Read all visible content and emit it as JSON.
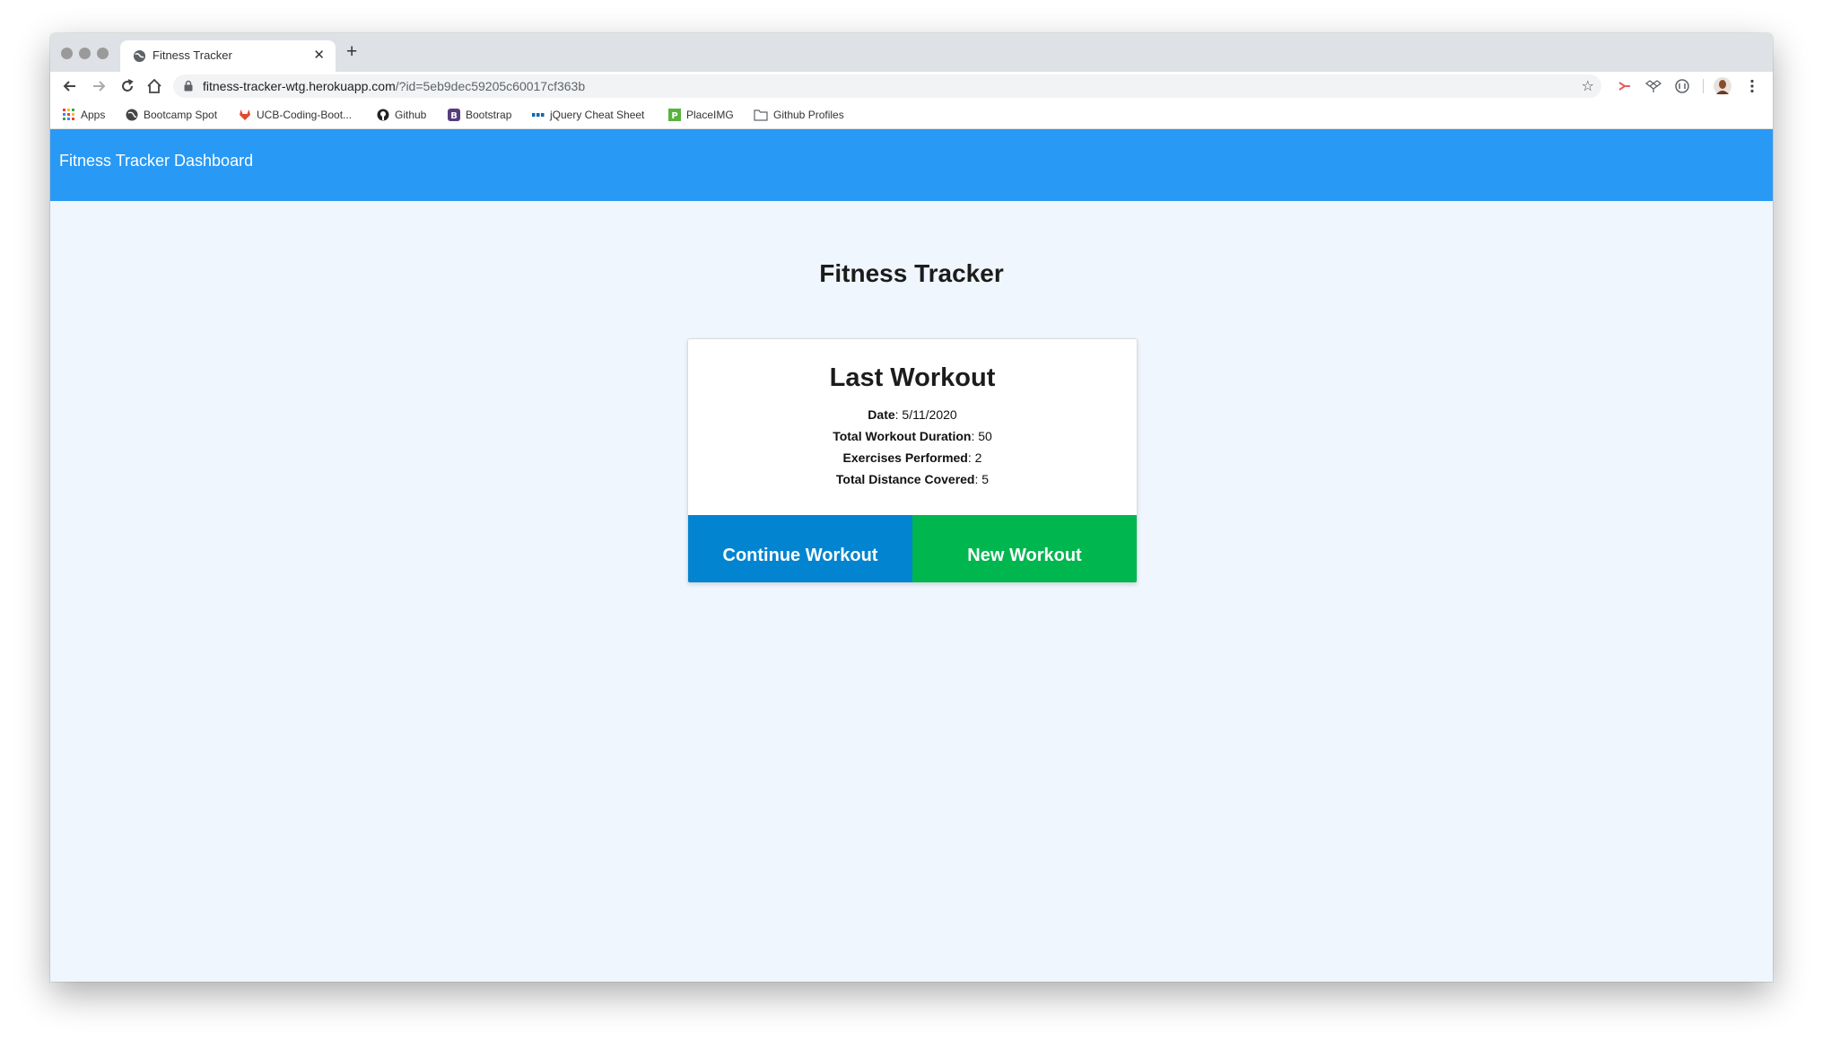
{
  "browser": {
    "tab_title": "Fitness Tracker",
    "tab_close": "✕",
    "new_tab": "+",
    "url_host": "fitness-tracker-wtg.herokuapp.com",
    "url_rest": "/?id=5eb9dec59205c60017cf363b",
    "star": "☆",
    "bookmarks": [
      {
        "label": "Apps",
        "icon": "apps-grid-icon"
      },
      {
        "label": "Bootcamp Spot",
        "icon": "bootcamp-spot-icon"
      },
      {
        "label": "UCB-Coding-Boot...",
        "icon": "gitlab-icon"
      },
      {
        "label": "Github",
        "icon": "github-icon"
      },
      {
        "label": "Bootstrap",
        "icon": "bootstrap-icon"
      },
      {
        "label": "jQuery Cheat Sheet",
        "icon": "jquery-icon"
      },
      {
        "label": "PlaceIMG",
        "icon": "placeimg-icon"
      },
      {
        "label": "Github Profiles",
        "icon": "folder-icon"
      }
    ]
  },
  "navbar": {
    "brand": "Fitness Tracker Dashboard"
  },
  "main": {
    "heading": "Fitness Tracker",
    "card": {
      "title": "Last Workout",
      "stats": [
        {
          "label": "Date",
          "value": ": 5/11/2020"
        },
        {
          "label": "Total Workout Duration",
          "value": ": 50"
        },
        {
          "label": "Exercises Performed",
          "value": ": 2"
        },
        {
          "label": "Total Distance Covered",
          "value": ": 5"
        }
      ],
      "continue_label": "Continue Workout",
      "new_label": "New Workout"
    }
  },
  "colors": {
    "navbar": "#2899f5",
    "background": "#eff6fe",
    "continue_button": "#0284d0",
    "new_button": "#00b64f"
  }
}
